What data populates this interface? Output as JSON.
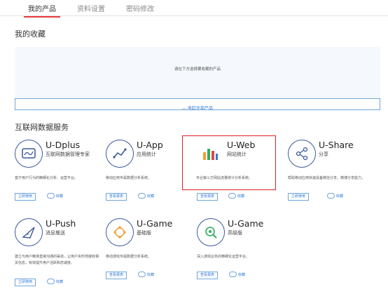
{
  "tabs": [
    "我的产品",
    "资料设置",
    "密码修改"
  ],
  "favorites": {
    "title": "我的收藏",
    "hint": "请在下方选择要收藏的产品",
    "collapse_label": "︿ 收起全部产品"
  },
  "services": {
    "title": "互联网数据服务",
    "cards": [
      {
        "name": "U-Dplus",
        "sub": "互联网数据管理专家",
        "desc": "基于用户行为的精细化分析、运营平台。",
        "button": "立即使用",
        "fav": "收藏"
      },
      {
        "name": "U-App",
        "sub": "应用统计",
        "desc": "移动应用专属数据分析系统。",
        "button": "查看报表",
        "fav": "收藏"
      },
      {
        "name": "U-Web",
        "sub": "网站统计",
        "desc": "专业第三方网站流量统计分析系统。",
        "button": "查看报表",
        "fav": "收藏"
      },
      {
        "name": "U-Share",
        "sub": "分享",
        "desc": "帮助移动应用快速具备微信分享、微博分享能力。",
        "button": "立即使用",
        "fav": "收藏"
      },
      {
        "name": "U-Push",
        "sub": "消息推送",
        "desc": "建立与用户精准直接沟通的渠道，让用户实时地接收相关信息，有效提升用户活跃和忠诚度。",
        "button": "立即使用",
        "fav": "收藏"
      },
      {
        "name": "U-Game",
        "sub": "基础版",
        "desc": "移动游戏专属数据分析系统。",
        "button": "查看报表",
        "fav": "收藏"
      },
      {
        "name": "U-Game",
        "sub": "高级版",
        "desc": "深入游戏业务的精细化运营平台。",
        "button": "查看报表",
        "fav": "收藏"
      }
    ]
  },
  "colors": {
    "accent": "#2f7ad6",
    "highlight": "#e02020",
    "tab_active": "#e63a3a"
  }
}
